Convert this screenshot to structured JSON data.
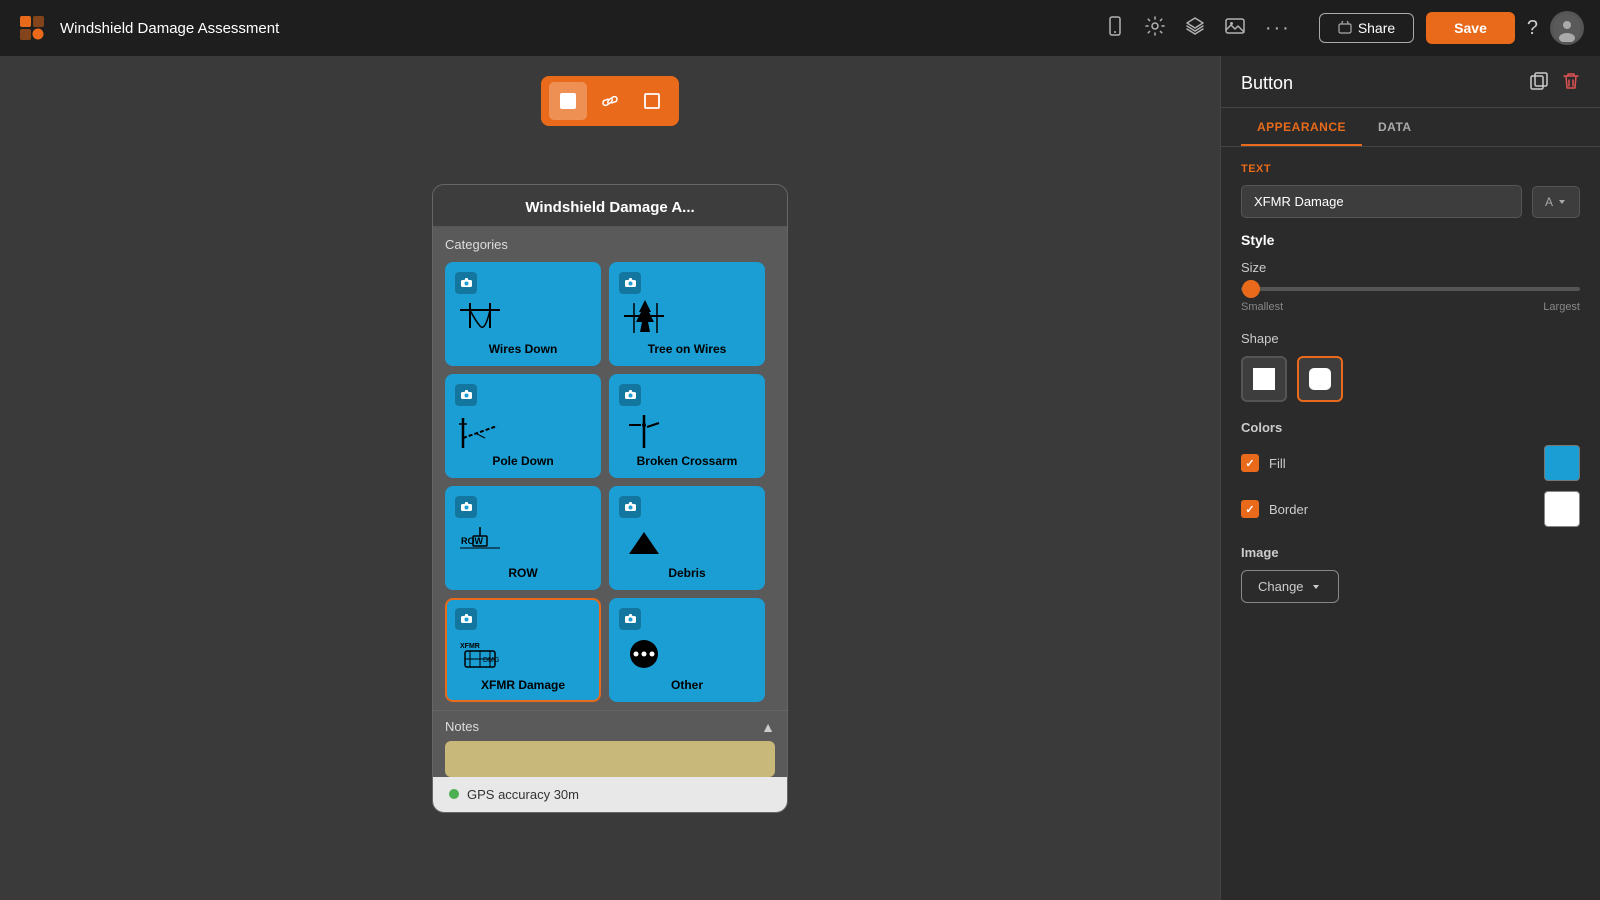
{
  "topbar": {
    "title": "Windshield Damage Assessment",
    "share_label": "Share",
    "save_label": "Save",
    "menu_dots": "···"
  },
  "toolbar": {
    "buttons": [
      {
        "id": "image-btn",
        "icon": "▪",
        "active": true
      },
      {
        "id": "link-btn",
        "icon": "🔗",
        "active": false
      },
      {
        "id": "frame-btn",
        "icon": "▢",
        "active": false
      }
    ]
  },
  "phone": {
    "title": "Windshield Damage A...",
    "categories_label": "Categories",
    "items": [
      {
        "id": "wires-down",
        "label": "Wires Down",
        "icon": "wires-icon"
      },
      {
        "id": "tree-on-wires",
        "label": "Tree on Wires",
        "icon": "tree-icon"
      },
      {
        "id": "pole-down",
        "label": "Pole Down",
        "icon": "pole-icon"
      },
      {
        "id": "broken-crossarm",
        "label": "Broken Crossarm",
        "icon": "crossarm-icon"
      },
      {
        "id": "row",
        "label": "ROW",
        "icon": "row-icon"
      },
      {
        "id": "debris",
        "label": "Debris",
        "icon": "debris-icon"
      },
      {
        "id": "xfmr-damage",
        "label": "XFMR Damage",
        "icon": "xfmr-icon",
        "selected": true
      },
      {
        "id": "other",
        "label": "Other",
        "icon": "other-icon"
      }
    ],
    "notes_label": "Notes",
    "gps_status": "GPS accuracy 30m"
  },
  "right_panel": {
    "title": "Button",
    "tabs": [
      {
        "id": "appearance",
        "label": "APPEARANCE",
        "active": true
      },
      {
        "id": "data",
        "label": "DATA",
        "active": false
      }
    ],
    "appearance": {
      "text_section_label": "Text",
      "text_value": "XFMR Damage",
      "text_align": "A",
      "style_title": "Style",
      "size_label": "Size",
      "size_min": "Smallest",
      "size_max": "Largest",
      "shape_label": "Shape",
      "shapes": [
        {
          "id": "square",
          "selected": false
        },
        {
          "id": "rounded",
          "selected": true
        }
      ],
      "colors_label": "Colors",
      "fill_label": "Fill",
      "fill_color": "#1a9ed4",
      "border_label": "Border",
      "border_color": "#ffffff",
      "image_label": "Image",
      "change_label": "Change"
    }
  }
}
